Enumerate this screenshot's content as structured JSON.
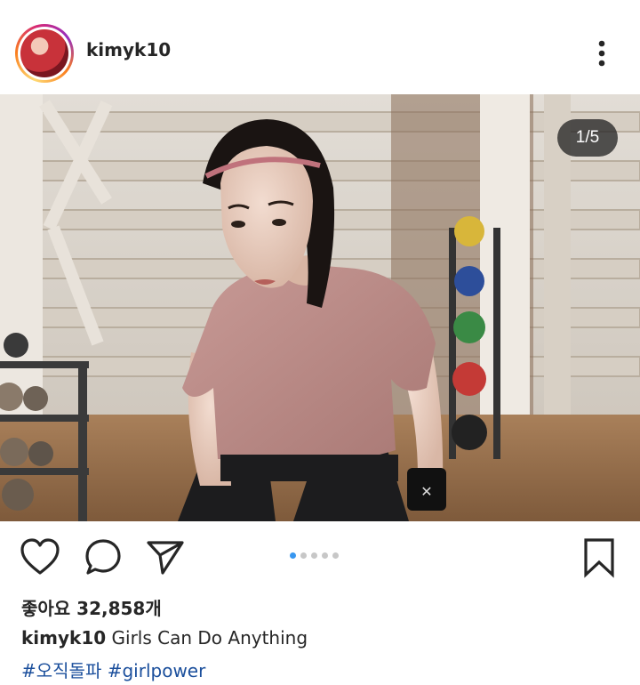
{
  "post": {
    "username": "kimyk10",
    "image_counter": "1/5",
    "carousel": {
      "total": 5,
      "active_index": 0
    },
    "likes_text": "좋아요 32,858개",
    "caption_user": "kimyk10",
    "caption_text": "Girls Can Do Anything",
    "hashtags": [
      "#오직돌파",
      "#girlpower"
    ]
  },
  "icons": {
    "more": "more-vertical-icon",
    "like": "heart-icon",
    "comment": "comment-icon",
    "share": "send-icon",
    "save": "bookmark-icon"
  },
  "colors": {
    "text": "#262626",
    "hashtag": "#1b4f9c",
    "active_dot": "#3897f0",
    "inactive_dot": "#c7c7c7"
  }
}
